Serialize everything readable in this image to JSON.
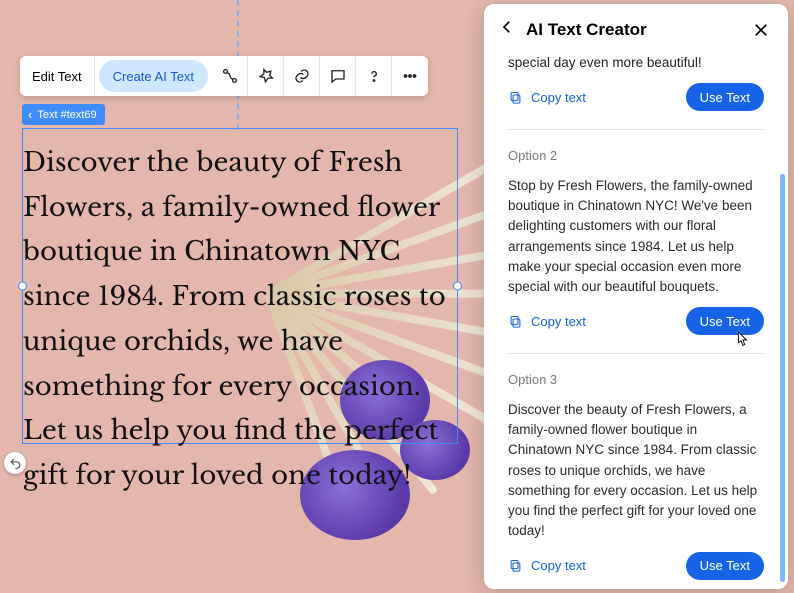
{
  "toolbar": {
    "edit_label": "Edit Text",
    "create_ai_label": "Create AI Text"
  },
  "selection": {
    "tag": "Text #text69",
    "content": "Discover the beauty of Fresh Flowers, a family-owned flower boutique in Chinatown NYC since 1984. From classic roses to unique orchids, we have something for every occasion. Let us help you find the perfect gift for your loved one today!"
  },
  "panel": {
    "title": "AI Text Creator",
    "copy_label": "Copy text",
    "use_label": "Use Text",
    "trail": "special day even more beautiful!",
    "options": [
      {
        "label": "Option 2",
        "body": "Stop by Fresh Flowers, the family-owned boutique in Chinatown NYC! We've been delighting customers with our floral arrangements since 1984. Let us help make your special occasion even more special with our beautiful bouquets."
      },
      {
        "label": "Option 3",
        "body": "Discover the beauty of Fresh Flowers, a family-owned flower boutique in Chinatown NYC since 1984. From classic roses to unique orchids, we have something for every occasion. Let us help you find the perfect gift for your loved one today!"
      }
    ]
  }
}
